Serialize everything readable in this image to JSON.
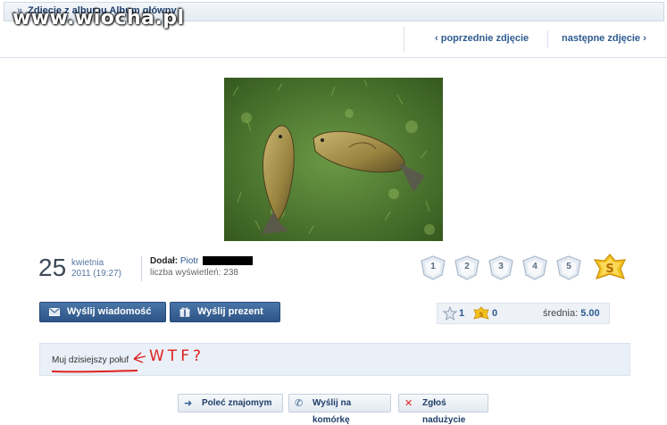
{
  "header": {
    "album_title": "Zdjęcie z albumu Album główny",
    "watermark": "www.wiocha.pl",
    "prev_label": "poprzednie zdjęcie",
    "next_label": "następne zdjęcie"
  },
  "photo": {
    "icon": "fish-photo"
  },
  "meta": {
    "day": "25",
    "month": "kwietnia",
    "time": "2011 (19:27)",
    "added_label": "Dodał:",
    "author": "Piotr",
    "views_text": "liczba wyświetleń: 238"
  },
  "rating": {
    "stars": [
      "1",
      "2",
      "3",
      "4",
      "5"
    ],
    "super_label": "S"
  },
  "actions": {
    "message_label": "Wyślij wiadomość",
    "gift_label": "Wyślij prezent"
  },
  "stats": {
    "stars_count": "1",
    "super_count": "0",
    "average_label": "średnia:",
    "average_value": "5.00"
  },
  "description": {
    "text": "Muj dzisiejszy połuf",
    "handwritten_note": "WTF?"
  },
  "bottom": {
    "recommend_label": "Poleć znajomym",
    "phone_label": "Wyślij na komórkę",
    "report_label": "Zgłoś nadużycie"
  },
  "colors": {
    "accent": "#2e5b91",
    "button": "#3a6499",
    "scribble": "#e02020"
  }
}
